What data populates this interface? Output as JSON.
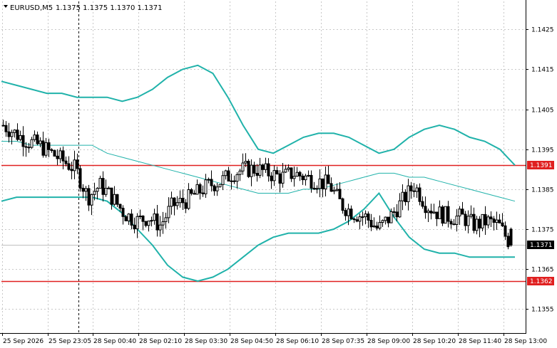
{
  "header": {
    "symbol_label": "EURUSD,M5",
    "quote_label": "1.1375 1.1375 1.1370 1.1371"
  },
  "chart_data": {
    "type": "candlestick",
    "symbol": "EURUSD",
    "timeframe": "M5",
    "ohlc_last": {
      "open": 1.1375,
      "high": 1.1375,
      "low": 1.137,
      "close": 1.1371
    },
    "ylim": [
      1.1349,
      1.1432
    ],
    "y_ticks": [
      1.1425,
      1.1415,
      1.1405,
      1.1395,
      1.1385,
      1.1375,
      1.1365,
      1.1355
    ],
    "x_ticks": [
      "25 Sep 2026",
      "25 Sep 23:05",
      "28 Sep 00:40",
      "28 Sep 02:10",
      "28 Sep 03:30",
      "28 Sep 04:50",
      "28 Sep 06:10",
      "28 Sep 07:35",
      "28 Sep 09:00",
      "28 Sep 10:20",
      "28 Sep 11:40",
      "28 Sep 13:00"
    ],
    "grid": true,
    "vertical_separator_after_tick": "25 Sep 23:05",
    "horizontal_levels": [
      {
        "value": 1.1391,
        "label": "1.1391",
        "color": "#e02020"
      },
      {
        "value": 1.1362,
        "label": "1.1362",
        "color": "#e02020"
      }
    ],
    "current_price": {
      "value": 1.1371,
      "label": "1.1371"
    },
    "bollinger": {
      "color": "#20b2aa",
      "upper": [
        1.1412,
        1.1411,
        1.141,
        1.1409,
        1.1409,
        1.1408,
        1.1408,
        1.1408,
        1.1407,
        1.1408,
        1.141,
        1.1413,
        1.1415,
        1.1416,
        1.1414,
        1.1408,
        1.1401,
        1.1395,
        1.1394,
        1.1396,
        1.1398,
        1.1399,
        1.1399,
        1.1398,
        1.1396,
        1.1394,
        1.1395,
        1.1398,
        1.14,
        1.1401,
        1.14,
        1.1398,
        1.1397,
        1.1395,
        1.1391
      ],
      "middle": [
        1.1397,
        1.1397,
        1.1396,
        1.1396,
        1.1396,
        1.1396,
        1.1396,
        1.1394,
        1.1393,
        1.1392,
        1.1391,
        1.139,
        1.1389,
        1.1388,
        1.1387,
        1.1386,
        1.1385,
        1.1384,
        1.1384,
        1.1384,
        1.1385,
        1.1385,
        1.1386,
        1.1387,
        1.1388,
        1.1389,
        1.1389,
        1.1388,
        1.1388,
        1.1387,
        1.1386,
        1.1385,
        1.1384,
        1.1383,
        1.1382
      ],
      "lower": [
        1.1382,
        1.1383,
        1.1383,
        1.1383,
        1.1383,
        1.1383,
        1.1383,
        1.1382,
        1.1379,
        1.1375,
        1.1371,
        1.1366,
        1.1363,
        1.1362,
        1.1363,
        1.1365,
        1.1368,
        1.1371,
        1.1373,
        1.1374,
        1.1374,
        1.1374,
        1.1375,
        1.1377,
        1.138,
        1.1384,
        1.1378,
        1.1373,
        1.137,
        1.1369,
        1.1369,
        1.1368,
        1.1368,
        1.1368,
        1.1368
      ]
    },
    "close_path": [
      1.1401,
      1.1399,
      1.1397,
      1.1396,
      1.1394,
      1.1392,
      1.139,
      1.1383,
      1.1386,
      1.1383,
      1.1379,
      1.1377,
      1.1378,
      1.1376,
      1.1381,
      1.1382,
      1.1384,
      1.1386,
      1.1387,
      1.1389,
      1.139,
      1.139,
      1.1389,
      1.1388,
      1.1389,
      1.1388,
      1.1387,
      1.1386,
      1.1381,
      1.1379,
      1.1378,
      1.1375,
      1.1378,
      1.1382,
      1.1386,
      1.1381,
      1.1379,
      1.1378,
      1.1378,
      1.1376,
      1.1377,
      1.1376,
      1.1371
    ]
  }
}
